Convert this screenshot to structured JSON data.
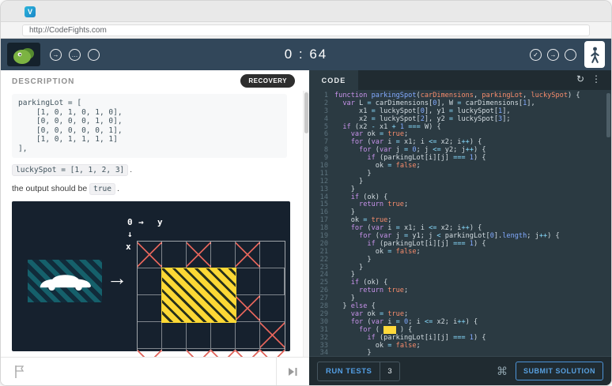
{
  "browser": {
    "url": "http://CodeFights.com",
    "favicon_letter": "V"
  },
  "header": {
    "timer": "0 : 64"
  },
  "icons": {
    "arrow_right": "→",
    "ellipsis": "…",
    "check": "✓",
    "kebab": "⋮",
    "refresh": "↻"
  },
  "left": {
    "title": "DESCRIPTION",
    "badge": "RECOVERY",
    "code_block": "parkingLot = [\n    [1, 0, 1, 0, 1, 0],\n    [0, 0, 0, 0, 1, 0],\n    [0, 0, 0, 0, 0, 1],\n    [1, 0, 1, 1, 1, 1]\n],",
    "lucky_code": "luckySpot = [1, 1, 2, 3]",
    "lucky_suffix": ".",
    "output_prefix": "the output should be",
    "output_value": "true",
    "output_suffix": "."
  },
  "viz": {
    "label_zero": "0",
    "arrow_y": "→",
    "label_y": "y",
    "arrow_x": "↓",
    "label_x": "x",
    "arrow": "→",
    "grid": {
      "rows": 4,
      "cols": 6,
      "blocked": [
        [
          0,
          0
        ],
        [
          0,
          2
        ],
        [
          0,
          4
        ],
        [
          1,
          4
        ],
        [
          2,
          5
        ],
        [
          3,
          0
        ],
        [
          3,
          2
        ],
        [
          3,
          3
        ],
        [
          3,
          4
        ],
        [
          3,
          5
        ]
      ],
      "spot": {
        "row": 1,
        "col": 1,
        "row_span": 2,
        "col_span": 3
      }
    },
    "colors": {
      "bg": "#16212e",
      "cross": "#e0635a",
      "spot_yellow": "#fdd835",
      "pad_teal": "#15606b"
    }
  },
  "editor": {
    "tab": "CODE",
    "theme": {
      "background": "#2b3a42",
      "keyword": "#c792ea",
      "function": "#82aaff",
      "param": "#f78c6c",
      "number": "#82aaff",
      "operator": "#89ddff"
    },
    "lines": [
      [
        [
          "k",
          "function"
        ],
        [
          "p",
          " "
        ],
        [
          "f",
          "parkingSpot"
        ],
        [
          "p",
          "("
        ],
        [
          "a",
          "carDimensions"
        ],
        [
          "p",
          ", "
        ],
        [
          "a",
          "parkingLot"
        ],
        [
          "p",
          ", "
        ],
        [
          "a",
          "luckySpot"
        ],
        [
          "p",
          ") {"
        ]
      ],
      [
        [
          "p",
          "  "
        ],
        [
          "k",
          "var"
        ],
        [
          "p",
          " L "
        ],
        [
          "o",
          "="
        ],
        [
          "p",
          " carDimensions["
        ],
        [
          "n",
          "0"
        ],
        [
          "p",
          "], W "
        ],
        [
          "o",
          "="
        ],
        [
          "p",
          " carDimensions["
        ],
        [
          "n",
          "1"
        ],
        [
          "p",
          "],"
        ]
      ],
      [
        [
          "p",
          "      x1 "
        ],
        [
          "o",
          "="
        ],
        [
          "p",
          " luckySpot["
        ],
        [
          "n",
          "0"
        ],
        [
          "p",
          "], y1 "
        ],
        [
          "o",
          "="
        ],
        [
          "p",
          " luckySpot["
        ],
        [
          "n",
          "1"
        ],
        [
          "p",
          "],"
        ]
      ],
      [
        [
          "p",
          "      x2 "
        ],
        [
          "o",
          "="
        ],
        [
          "p",
          " luckySpot["
        ],
        [
          "n",
          "2"
        ],
        [
          "p",
          "], y2 "
        ],
        [
          "o",
          "="
        ],
        [
          "p",
          " luckySpot["
        ],
        [
          "n",
          "3"
        ],
        [
          "p",
          "];"
        ]
      ],
      [
        [
          "p",
          "  "
        ],
        [
          "k",
          "if"
        ],
        [
          "p",
          " (x2 "
        ],
        [
          "o",
          "-"
        ],
        [
          "p",
          " x1 "
        ],
        [
          "o",
          "+"
        ],
        [
          "p",
          " "
        ],
        [
          "n",
          "1"
        ],
        [
          "p",
          " "
        ],
        [
          "o",
          "==="
        ],
        [
          "p",
          " W) {"
        ]
      ],
      [
        [
          "p",
          "    "
        ],
        [
          "k",
          "var"
        ],
        [
          "p",
          " ok "
        ],
        [
          "o",
          "="
        ],
        [
          "p",
          " "
        ],
        [
          "a",
          "true"
        ],
        [
          "p",
          ";"
        ]
      ],
      [
        [
          "p",
          "    "
        ],
        [
          "k",
          "for"
        ],
        [
          "p",
          " ("
        ],
        [
          "k",
          "var"
        ],
        [
          "p",
          " i "
        ],
        [
          "o",
          "="
        ],
        [
          "p",
          " x1; i "
        ],
        [
          "o",
          "<="
        ],
        [
          "p",
          " x2; i"
        ],
        [
          "o",
          "++"
        ],
        [
          "p",
          ") {"
        ]
      ],
      [
        [
          "p",
          "      "
        ],
        [
          "k",
          "for"
        ],
        [
          "p",
          " ("
        ],
        [
          "k",
          "var"
        ],
        [
          "p",
          " j "
        ],
        [
          "o",
          "="
        ],
        [
          "p",
          " "
        ],
        [
          "n",
          "0"
        ],
        [
          "p",
          "; j "
        ],
        [
          "o",
          "<="
        ],
        [
          "p",
          " y2; j"
        ],
        [
          "o",
          "++"
        ],
        [
          "p",
          ") {"
        ]
      ],
      [
        [
          "p",
          "        "
        ],
        [
          "k",
          "if"
        ],
        [
          "p",
          " (parkingLot[i][j] "
        ],
        [
          "o",
          "==="
        ],
        [
          "p",
          " "
        ],
        [
          "n",
          "1"
        ],
        [
          "p",
          ") {"
        ]
      ],
      [
        [
          "p",
          "          ok "
        ],
        [
          "o",
          "="
        ],
        [
          "p",
          " "
        ],
        [
          "a",
          "false"
        ],
        [
          "p",
          ";"
        ]
      ],
      [
        [
          "p",
          "        }"
        ]
      ],
      [
        [
          "p",
          "      }"
        ]
      ],
      [
        [
          "p",
          "    }"
        ]
      ],
      [
        [
          "p",
          "    "
        ],
        [
          "k",
          "if"
        ],
        [
          "p",
          " (ok) {"
        ]
      ],
      [
        [
          "p",
          "      "
        ],
        [
          "k",
          "return"
        ],
        [
          "p",
          " "
        ],
        [
          "a",
          "true"
        ],
        [
          "p",
          ";"
        ]
      ],
      [
        [
          "p",
          "    }"
        ]
      ],
      [
        [
          "p",
          "    ok "
        ],
        [
          "o",
          "="
        ],
        [
          "p",
          " "
        ],
        [
          "a",
          "true"
        ],
        [
          "p",
          ";"
        ]
      ],
      [
        [
          "p",
          "    "
        ],
        [
          "k",
          "for"
        ],
        [
          "p",
          " ("
        ],
        [
          "k",
          "var"
        ],
        [
          "p",
          " i "
        ],
        [
          "o",
          "="
        ],
        [
          "p",
          " x1; i "
        ],
        [
          "o",
          "<="
        ],
        [
          "p",
          " x2; i"
        ],
        [
          "o",
          "++"
        ],
        [
          "p",
          ") {"
        ]
      ],
      [
        [
          "p",
          "      "
        ],
        [
          "k",
          "for"
        ],
        [
          "p",
          " ("
        ],
        [
          "k",
          "var"
        ],
        [
          "p",
          " j "
        ],
        [
          "o",
          "="
        ],
        [
          "p",
          " y1; j "
        ],
        [
          "o",
          "<"
        ],
        [
          "p",
          " parkingLot["
        ],
        [
          "n",
          "0"
        ],
        [
          "p",
          "]."
        ],
        [
          "f",
          "length"
        ],
        [
          "p",
          "; j"
        ],
        [
          "o",
          "++"
        ],
        [
          "p",
          ") {"
        ]
      ],
      [
        [
          "p",
          "        "
        ],
        [
          "k",
          "if"
        ],
        [
          "p",
          " (parkingLot[i][j] "
        ],
        [
          "o",
          "==="
        ],
        [
          "p",
          " "
        ],
        [
          "n",
          "1"
        ],
        [
          "p",
          ") {"
        ]
      ],
      [
        [
          "p",
          "          ok "
        ],
        [
          "o",
          "="
        ],
        [
          "p",
          " "
        ],
        [
          "a",
          "false"
        ],
        [
          "p",
          ";"
        ]
      ],
      [
        [
          "p",
          "        }"
        ]
      ],
      [
        [
          "p",
          "      }"
        ]
      ],
      [
        [
          "p",
          "    }"
        ]
      ],
      [
        [
          "p",
          "    "
        ],
        [
          "k",
          "if"
        ],
        [
          "p",
          " (ok) {"
        ]
      ],
      [
        [
          "p",
          "      "
        ],
        [
          "k",
          "return"
        ],
        [
          "p",
          " "
        ],
        [
          "a",
          "true"
        ],
        [
          "p",
          ";"
        ]
      ],
      [
        [
          "p",
          "    }"
        ]
      ],
      [
        [
          "p",
          "  } "
        ],
        [
          "k",
          "else"
        ],
        [
          "p",
          " {"
        ]
      ],
      [
        [
          "p",
          "    "
        ],
        [
          "k",
          "var"
        ],
        [
          "p",
          " ok "
        ],
        [
          "o",
          "="
        ],
        [
          "p",
          " "
        ],
        [
          "a",
          "true"
        ],
        [
          "p",
          ";"
        ]
      ],
      [
        [
          "p",
          "    "
        ],
        [
          "k",
          "for"
        ],
        [
          "p",
          " ("
        ],
        [
          "k",
          "var"
        ],
        [
          "p",
          " i "
        ],
        [
          "o",
          "="
        ],
        [
          "p",
          " "
        ],
        [
          "n",
          "0"
        ],
        [
          "p",
          "; i "
        ],
        [
          "o",
          "<="
        ],
        [
          "p",
          " x2; i"
        ],
        [
          "o",
          "++"
        ],
        [
          "p",
          ") {"
        ]
      ],
      [
        [
          "p",
          "      "
        ],
        [
          "k",
          "for"
        ],
        [
          "p",
          " ( "
        ],
        [
          "hl",
          "   "
        ],
        [
          "p",
          " ) {"
        ]
      ],
      [
        [
          "p",
          "        "
        ],
        [
          "k",
          "if"
        ],
        [
          "p",
          " (parkingLot[i][j] "
        ],
        [
          "o",
          "==="
        ],
        [
          "p",
          " "
        ],
        [
          "n",
          "1"
        ],
        [
          "p",
          ") {"
        ]
      ],
      [
        [
          "p",
          "          ok "
        ],
        [
          "o",
          "="
        ],
        [
          "p",
          " "
        ],
        [
          "a",
          "false"
        ],
        [
          "p",
          ";"
        ]
      ],
      [
        [
          "p",
          "        }"
        ]
      ]
    ]
  },
  "footer": {
    "run_tests": "RUN TESTS",
    "count": "3",
    "cmd_icon": "⌘",
    "submit": "SUBMIT SOLUTION"
  }
}
